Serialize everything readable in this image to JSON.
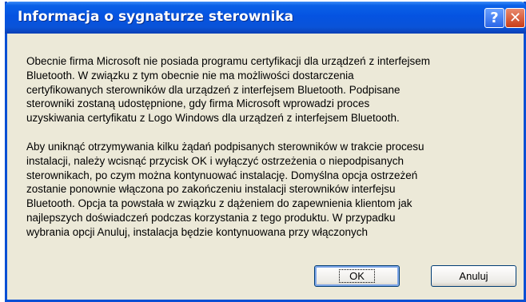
{
  "window": {
    "title": "Informacja o sygnaturze sterownika",
    "help_glyph": "?",
    "close_glyph": "✕"
  },
  "message": {
    "lines": [
      "Obecnie firma Microsoft nie posiada programu certyfikacji dla urządzeń z interfejsem",
      "Bluetooth. W związku z tym obecnie nie ma możliwości dostarczenia",
      "certyfikowanych sterowników dla urządzeń z interfejsem Bluetooth.  Podpisane",
      "sterowniki zostaną udostępnione, gdy firma Microsoft wprowadzi proces",
      "uzyskiwania certyfikatu z Logo Windows dla urządzeń z interfejsem Bluetooth.",
      "Aby uniknąć otrzymywania kilku żądań podpisanych sterowników w trakcie procesu",
      "instalacji, należy wcisnąć przycisk OK i wyłączyć ostrzeżenia o niepodpisanych",
      "sterownikach, po czym można kontynuować instalację. Domyślna opcja ostrzeżeń",
      "zostanie ponownie włączona po zakończeniu instalacji sterowników interfejsu",
      "Bluetooth. Opcja ta powstała w związku z dążeniem do zapewnienia klientom jak",
      "najlepszych doświadczeń podczas korzystania z tego produktu. W przypadku",
      "wybrania opcji Anuluj, instalacja będzie kontynuowana przy włączonych"
    ]
  },
  "buttons": {
    "ok": "OK",
    "cancel": "Anuluj"
  }
}
